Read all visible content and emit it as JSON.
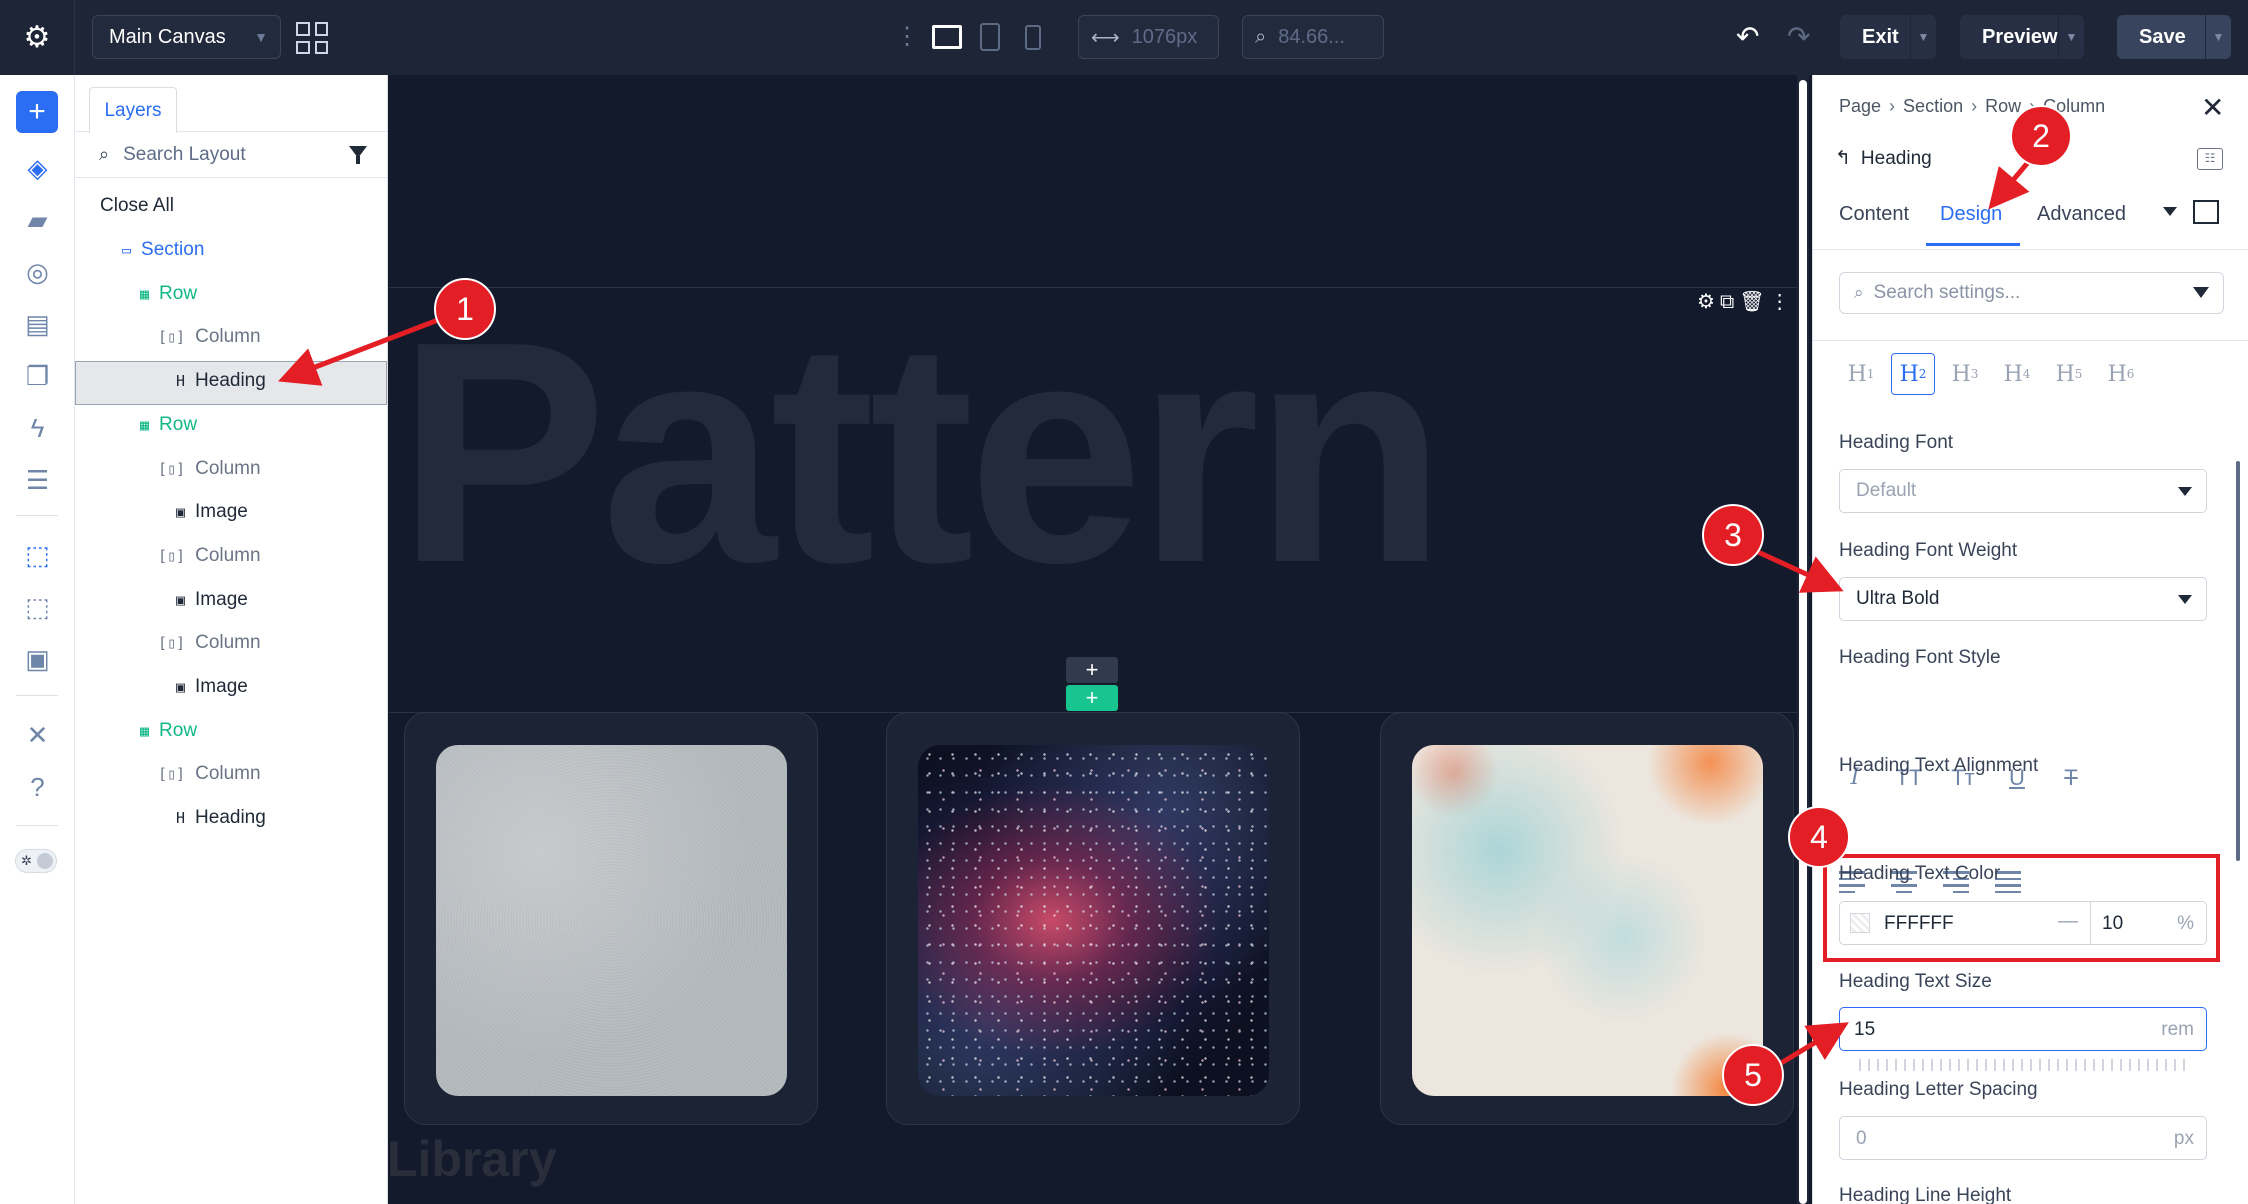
{
  "topbar": {
    "canvas_label": "Main Canvas",
    "width_value": "1076px",
    "zoom_value": "84.66...",
    "exit_label": "Exit",
    "preview_label": "Preview",
    "save_label": "Save"
  },
  "layers": {
    "tab_label": "Layers",
    "search_placeholder": "Search Layout",
    "close_all": "Close All",
    "tree": [
      {
        "label": "Section",
        "kind": "section",
        "indent": 1
      },
      {
        "label": "Row",
        "kind": "row",
        "indent": 2
      },
      {
        "label": "Column",
        "kind": "column",
        "indent": 3
      },
      {
        "label": "Heading",
        "kind": "heading",
        "indent": 4,
        "selected": true
      },
      {
        "label": "Row",
        "kind": "row",
        "indent": 2
      },
      {
        "label": "Column",
        "kind": "column",
        "indent": 3
      },
      {
        "label": "Image",
        "kind": "image",
        "indent": 4
      },
      {
        "label": "Column",
        "kind": "column",
        "indent": 3
      },
      {
        "label": "Image",
        "kind": "image",
        "indent": 4
      },
      {
        "label": "Column",
        "kind": "column",
        "indent": 3
      },
      {
        "label": "Image",
        "kind": "image",
        "indent": 4
      },
      {
        "label": "Row",
        "kind": "row",
        "indent": 2
      },
      {
        "label": "Column",
        "kind": "column",
        "indent": 3
      },
      {
        "label": "Heading",
        "kind": "heading",
        "indent": 4
      }
    ]
  },
  "canvas": {
    "heading_text": "Pattern",
    "footer_heading": "Library"
  },
  "settings": {
    "breadcrumb": [
      "Page",
      "Section",
      "Row",
      "Column"
    ],
    "module_title": "Heading",
    "tabs": [
      "Content",
      "Design",
      "Advanced"
    ],
    "active_tab": "Design",
    "search_placeholder": "Search settings...",
    "heading_levels": [
      "H1",
      "H2",
      "H3",
      "H4",
      "H5",
      "H6"
    ],
    "active_level": "H2",
    "heading_font_label": "Heading Font",
    "heading_font_value": "Default",
    "font_weight_label": "Heading Font Weight",
    "font_weight_value": "Ultra Bold",
    "font_style_label": "Heading Font Style",
    "text_alignment_label": "Heading Text Alignment",
    "text_color_label": "Heading Text Color",
    "text_color_hex": "FFFFFF",
    "text_color_opacity": "10",
    "text_color_unit": "%",
    "text_size_label": "Heading Text Size",
    "text_size_value": "15",
    "text_size_unit": "rem",
    "letter_spacing_label": "Heading Letter Spacing",
    "letter_spacing_placeholder": "0",
    "letter_spacing_unit": "px",
    "line_height_label": "Heading Line Height"
  },
  "annotations": [
    "1",
    "2",
    "3",
    "4",
    "5"
  ],
  "colors": {
    "accent": "#2b6ef3",
    "row_green": "#11b886",
    "annotation_red": "#e31e24",
    "canvas_bg": "#121a2c"
  }
}
